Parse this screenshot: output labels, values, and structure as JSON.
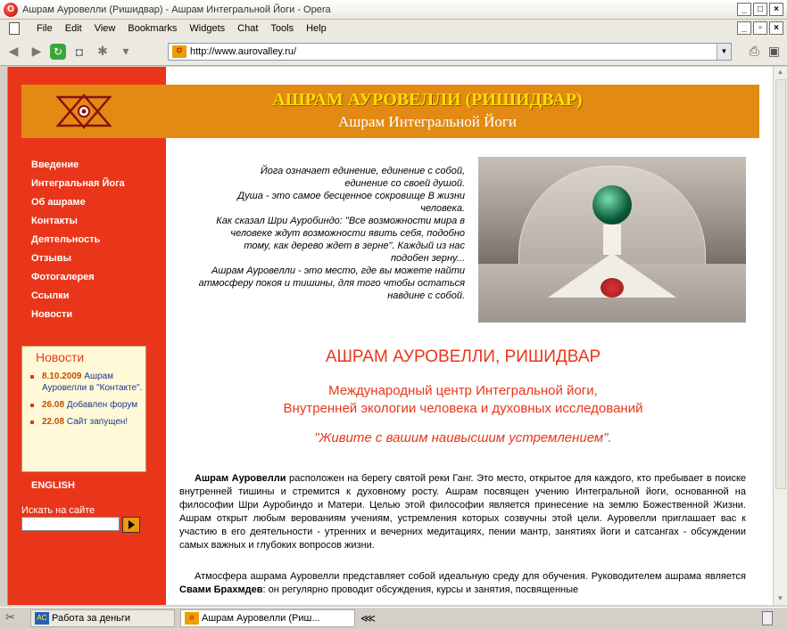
{
  "window": {
    "app_icon": "opera-icon",
    "title": "Ашрам Ауровелли (Ришидвар) - Ашрам Интегральной Йоги - Opera"
  },
  "menu": [
    "File",
    "Edit",
    "View",
    "Bookmarks",
    "Widgets",
    "Chat",
    "Tools",
    "Help"
  ],
  "address": {
    "url": "http://www.aurovalley.ru/"
  },
  "site": {
    "banner_title": "АШРАМ  АУРОВЕЛЛИ (РИШИДВАР)",
    "banner_subtitle": "Ашрам Интегральной Йоги",
    "nav": [
      "Введение",
      "Интегральная Йога",
      "Об ашраме",
      "Контакты",
      "Деятельность",
      "Отзывы",
      "Фотогалерея",
      "Ссылки",
      "Новости"
    ],
    "news": {
      "heading": "Новости",
      "items": [
        {
          "date": "8.10.2009",
          "text": "Ашрам Ауровелли в \"Контакте\"."
        },
        {
          "date": "26.08",
          "text": "Добавлен форум"
        },
        {
          "date": "22.08",
          "text": "Сайт запущен!"
        }
      ]
    },
    "english_link": "ENGLISH",
    "search_label": "Искать на сайте",
    "quote_lines": [
      "Йога означает единение, единение с собой,",
      "единение со своей душой.",
      "Душа - это самое бесценное сокровище В жизни",
      "человека.",
      "Как сказал Шри Ауробиндо: \"Все возможности мира в",
      "человеке ждут возможности явить себя, подобно",
      "тому, как дерево ждет в зерне\". Каждый из нас",
      "подобен зерну...",
      "Ашрам Ауровелли - это место, где вы можете найти",
      "атмосферу покоя и тишины, для того чтобы остаться",
      "навдине с собой."
    ],
    "heading": "АШРАМ АУРОВЕЛЛИ, РИШИДВАР",
    "subheading_line1": "Международный центр Интегральной йоги,",
    "subheading_line2": "Внутренней экологии человека и духовных исследований",
    "motto": "\"Живите с вашим наивысшим устремлением\".",
    "para1_bold": "Ашрам Ауровелли",
    "para1_text": " расположен на берегу святой реки Ганг. Это место, открытое для каждого, кто пребывает в поиске внутренней тишины и стремится к духовному росту. Ашрам посвящен учению Интегральной йоги, основанной на философии Шри Ауробиндо и Матери. Целью этой философии является принесение на землю Божественной Жизни. Ашрам открыт любым верованиям учениям, устремления которых созвучны этой цели. Ауровелли приглашает вас к участию в его деятельности - утренних и вечерних медитациях, пении мантр, занятиях йоги и сатсангах - обсуждении самых важных и глубоких вопросов жизни.",
    "para2_text_a": "Атмосфера ашрама Ауровелли представляет собой идеальную среду для обучения. Руководителем ашрама является ",
    "para2_bold": "Свами Брахмдев",
    "para2_text_b": ": он регулярно проводит обсуждения, курсы и занятия, посвященные"
  },
  "taskbar": {
    "task1": "Работа за деньги",
    "task2": "Ашрам Ауровелли (Риш..."
  }
}
